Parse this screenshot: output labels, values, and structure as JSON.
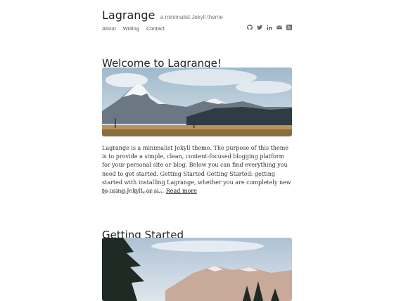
{
  "header": {
    "site_name": "Lagrange",
    "tagline": "a minimalist Jekyll theme",
    "nav": [
      "About",
      "Writing",
      "Contact"
    ],
    "social_icons": [
      "github-icon",
      "twitter-icon",
      "linkedin-icon",
      "email-icon",
      "rss-icon"
    ]
  },
  "posts": [
    {
      "title": "Welcome to Lagrange!",
      "excerpt": "Lagrange is a minimalist Jekyll theme. The purpose of this theme is to provide a simple, clean, content-focused blogging platform for your personal site or blog. Below you can find everything you need to get started. Getting Started Getting Started: getting started with installing Lagrange, whether you are completely new to using Jekyll, or si...",
      "read_more": "Read more",
      "date": "01 Jan 2016",
      "separator": "-",
      "reading_time": "1 minute read"
    },
    {
      "title": "Getting Started"
    }
  ],
  "colors": {
    "text": "#2b2b2b",
    "muted": "#888888",
    "background": "#ffffff"
  }
}
